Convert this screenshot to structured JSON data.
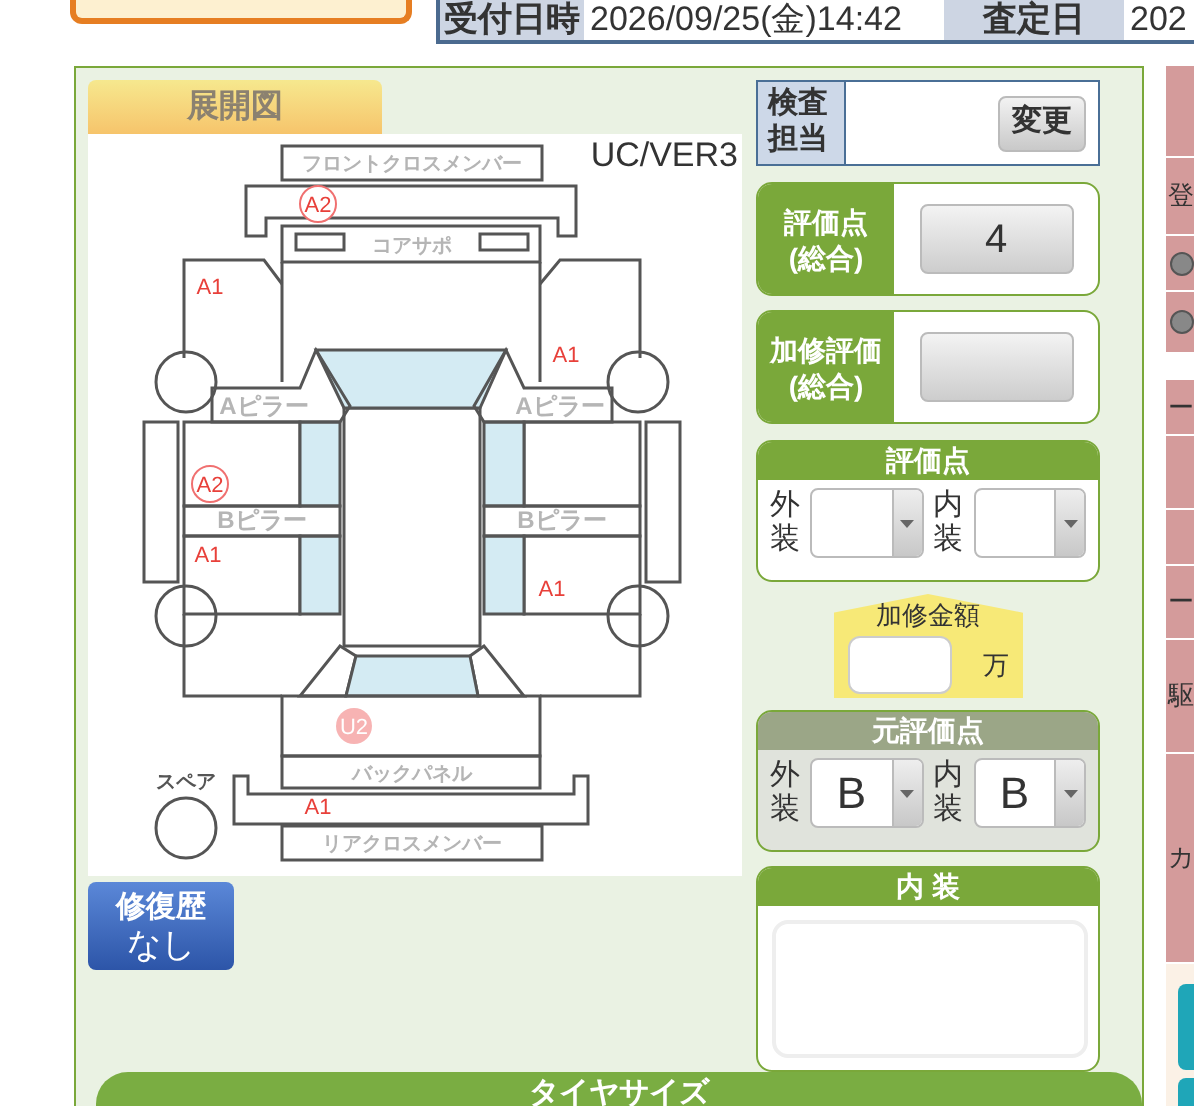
{
  "header": {
    "cells": [
      {
        "kind": "label",
        "text": "受付日時"
      },
      {
        "kind": "value",
        "text": "2026/09/25(金)14:42"
      },
      {
        "kind": "label",
        "text": "査定日"
      },
      {
        "kind": "value",
        "text": "202"
      }
    ]
  },
  "diagram": {
    "tab": "展開図",
    "version": "UC/VER3",
    "panel_labels": [
      "フロントクロスメンバー",
      "コアサポ",
      "Aピラー",
      "Aピラー",
      "Bピラー",
      "Bピラー",
      "バックパネル",
      "リアクロスメンバー",
      "スペア"
    ],
    "marks": [
      {
        "code": "A2",
        "kind": "circled"
      },
      {
        "code": "A1",
        "kind": "plain"
      },
      {
        "code": "A1",
        "kind": "plain"
      },
      {
        "code": "A2",
        "kind": "circled"
      },
      {
        "code": "A1",
        "kind": "plain"
      },
      {
        "code": "A1",
        "kind": "plain"
      },
      {
        "code": "U2",
        "kind": "filled"
      },
      {
        "code": "A1",
        "kind": "plain"
      }
    ]
  },
  "repair_history_button": {
    "title": "修復歴",
    "value": "なし"
  },
  "inspector": {
    "label": "検査担当",
    "button": "変更"
  },
  "overall_score": {
    "label": "評価点",
    "sublabel": "(総合)",
    "value": "4"
  },
  "repair_score": {
    "label": "加修評価",
    "sublabel": "(総合)"
  },
  "score": {
    "title": "評価点",
    "exterior_label": "外装",
    "interior_label": "内装"
  },
  "repair_amount": {
    "label": "加修金額",
    "unit": "万"
  },
  "original_score": {
    "title": "元評価点",
    "exterior_label": "外装",
    "exterior_value": "B",
    "interior_label": "内装",
    "interior_value": "B"
  },
  "interior": {
    "title": "内 装"
  },
  "tire_size": {
    "title": "タイヤサイズ"
  },
  "side_panel": {
    "rows": [
      {
        "kind": "blank"
      },
      {
        "kind": "text",
        "text": "登"
      },
      {
        "kind": "icon"
      },
      {
        "kind": "icon"
      },
      {
        "kind": "gap"
      },
      {
        "kind": "text",
        "text": "ー"
      },
      {
        "kind": "blank"
      },
      {
        "kind": "blank"
      },
      {
        "kind": "text",
        "text": "ー"
      },
      {
        "kind": "text",
        "text": "駆"
      },
      {
        "kind": "text",
        "text": "カ"
      },
      {
        "kind": "buttons"
      }
    ]
  }
}
